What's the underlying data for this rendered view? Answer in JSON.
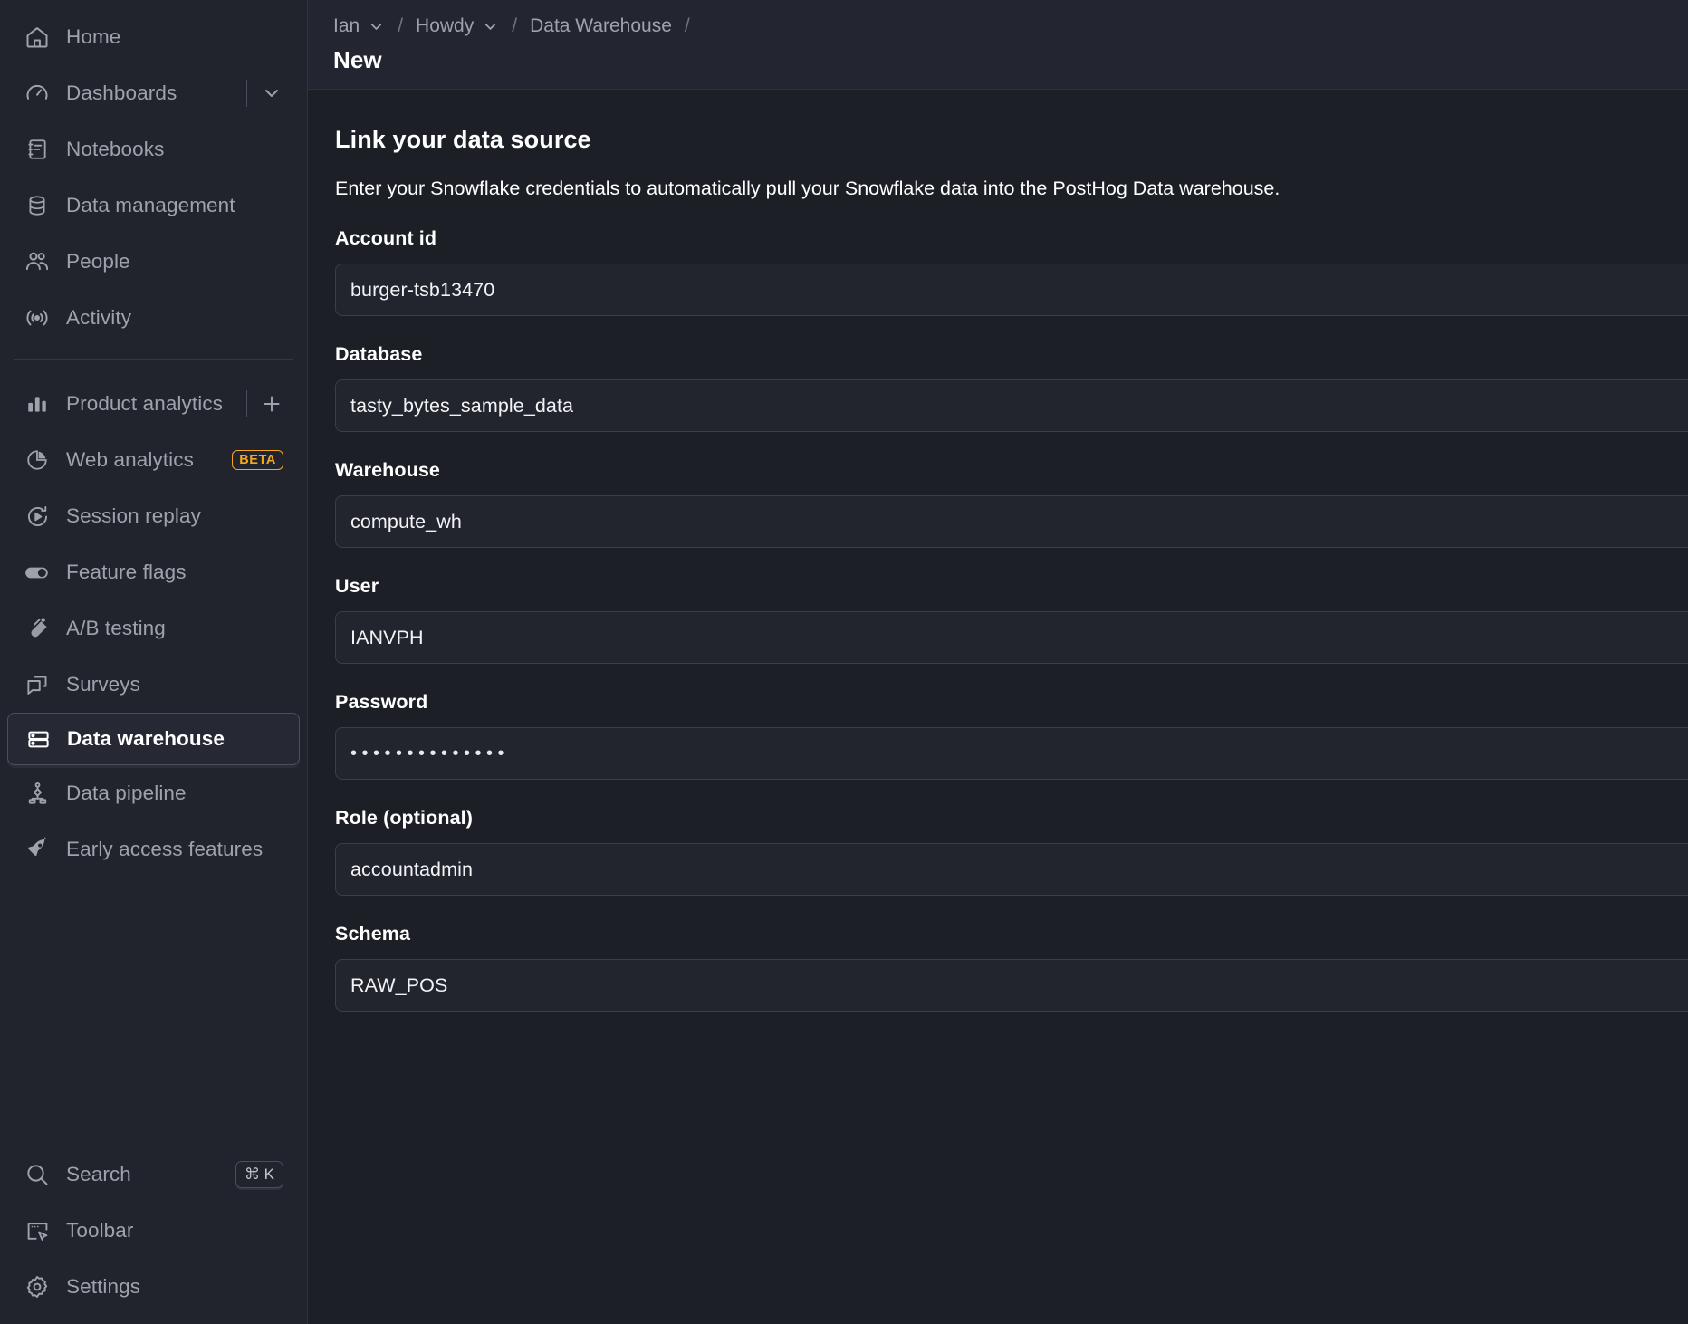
{
  "sidebar": {
    "primary_items": [
      {
        "label": "Home",
        "icon": "home-icon"
      },
      {
        "label": "Dashboards",
        "icon": "gauge-icon",
        "has_divider_chevron": true
      },
      {
        "label": "Notebooks",
        "icon": "notebook-icon"
      },
      {
        "label": "Data management",
        "icon": "database-icon"
      },
      {
        "label": "People",
        "icon": "people-icon"
      },
      {
        "label": "Activity",
        "icon": "activity-icon"
      }
    ],
    "product_items": [
      {
        "label": "Product analytics",
        "icon": "bar-chart-icon",
        "has_add": true
      },
      {
        "label": "Web analytics",
        "icon": "pie-chart-icon",
        "badge": "BETA"
      },
      {
        "label": "Session replay",
        "icon": "play-replay-icon"
      },
      {
        "label": "Feature flags",
        "icon": "toggle-icon"
      },
      {
        "label": "A/B testing",
        "icon": "flask-icon"
      },
      {
        "label": "Surveys",
        "icon": "chat-bubbles-icon"
      },
      {
        "label": "Data warehouse",
        "icon": "server-icon",
        "active": true
      },
      {
        "label": "Data pipeline",
        "icon": "pipeline-icon"
      },
      {
        "label": "Early access features",
        "icon": "rocket-icon"
      }
    ],
    "bottom_items": [
      {
        "label": "Search",
        "icon": "search-icon",
        "shortcut": "⌘ K"
      },
      {
        "label": "Toolbar",
        "icon": "toolbar-icon"
      },
      {
        "label": "Settings",
        "icon": "gear-icon"
      }
    ],
    "beta_badge_color": "#f5a623"
  },
  "header": {
    "breadcrumbs": [
      {
        "label": "Ian",
        "has_chevron": true
      },
      {
        "label": "Howdy",
        "has_chevron": true
      },
      {
        "label": "Data Warehouse",
        "has_chevron": false
      }
    ],
    "separator": "/",
    "trailing_separator": "/",
    "page_title": "New"
  },
  "form": {
    "title": "Link your data source",
    "description": "Enter your Snowflake credentials to automatically pull your Snowflake data into the PostHog Data warehouse.",
    "fields": [
      {
        "label": "Account id",
        "value": "burger-tsb13470",
        "type": "text"
      },
      {
        "label": "Database",
        "value": "tasty_bytes_sample_data",
        "type": "text"
      },
      {
        "label": "Warehouse",
        "value": "compute_wh",
        "type": "text"
      },
      {
        "label": "User",
        "value": "IANVPH",
        "type": "text"
      },
      {
        "label": "Password",
        "value": "••••••••••••••",
        "type": "password"
      },
      {
        "label": "Role (optional)",
        "value": "accountadmin",
        "type": "text"
      },
      {
        "label": "Schema",
        "value": "RAW_POS",
        "type": "text"
      }
    ]
  }
}
